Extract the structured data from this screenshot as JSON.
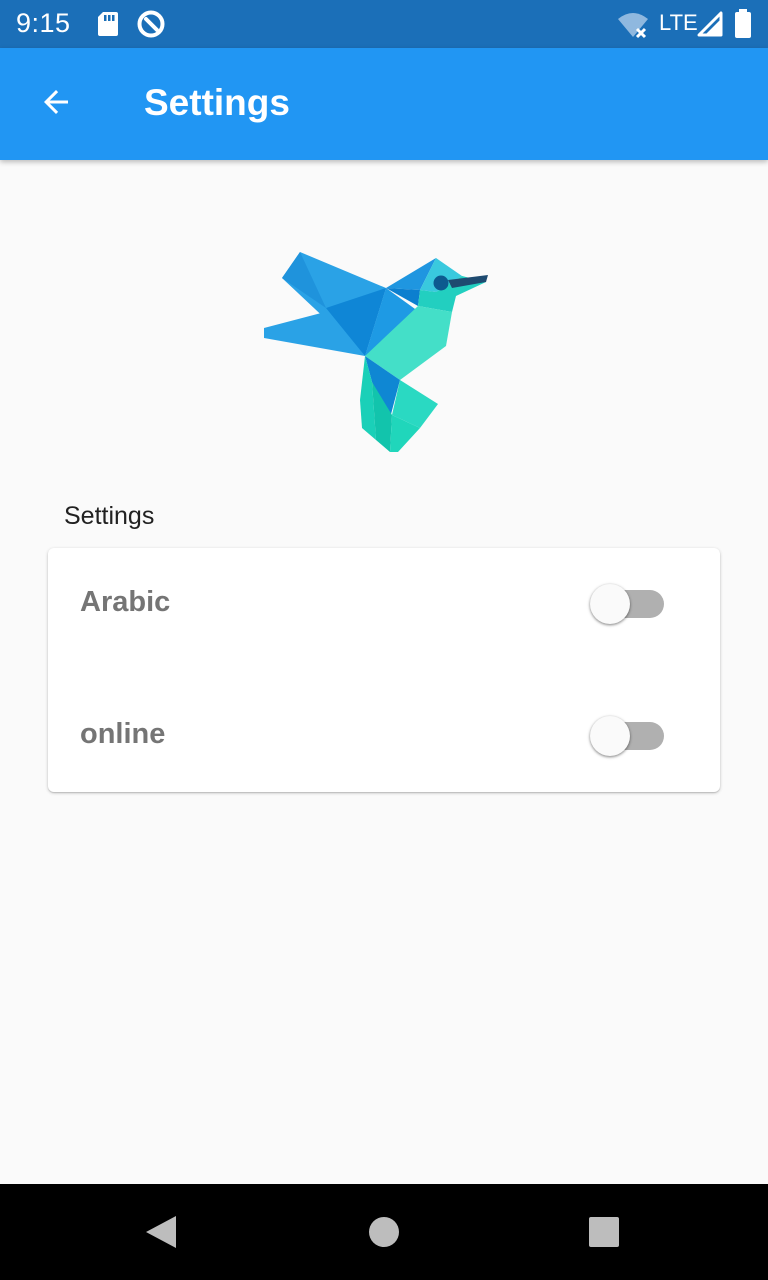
{
  "status_bar": {
    "time": "9:15",
    "network": "LTE",
    "icons": [
      "sd-card-icon",
      "data-saver-icon",
      "wifi-off-icon",
      "signal-icon",
      "battery-icon"
    ]
  },
  "app_bar": {
    "title": "Settings",
    "back_icon": "arrow-back-icon",
    "color": "#2196f3"
  },
  "logo": {
    "icon": "hummingbird-logo"
  },
  "settings": {
    "section_label": "Settings",
    "items": [
      {
        "label": "Arabic",
        "enabled": false
      },
      {
        "label": "online",
        "enabled": false
      }
    ]
  },
  "nav_bar": {
    "icons": [
      "back-triangle-icon",
      "home-circle-icon",
      "recents-square-icon"
    ]
  }
}
